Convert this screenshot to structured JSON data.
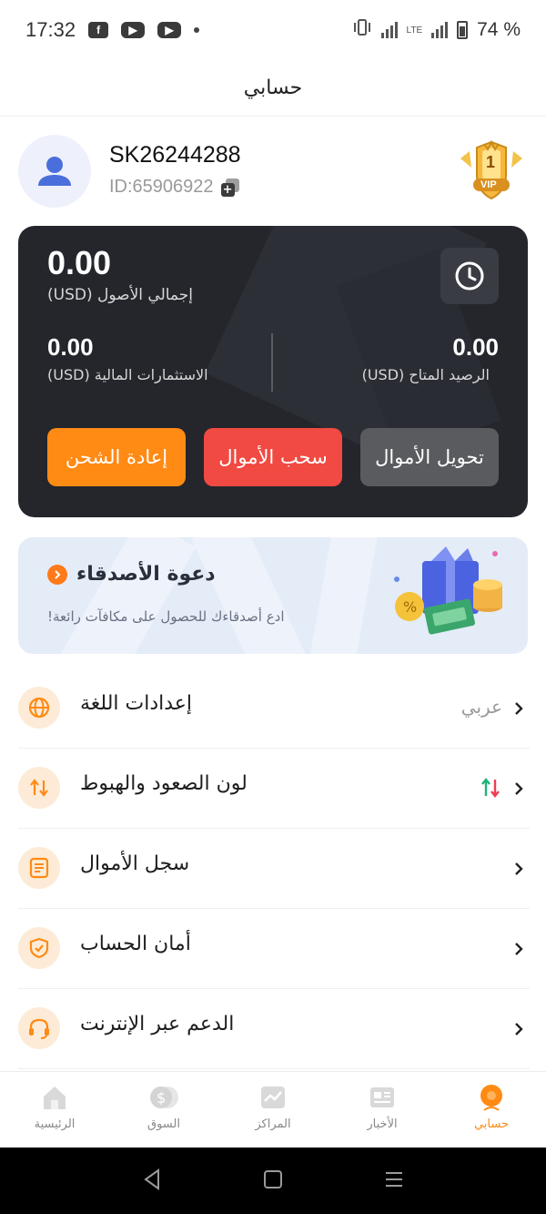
{
  "status_bar": {
    "time": "17:32",
    "apps": [
      "facebook-icon",
      "youtube-icon",
      "youtube-icon"
    ],
    "network": "LTE",
    "battery": "74 %"
  },
  "header": {
    "title": "حسابي"
  },
  "profile": {
    "username": "SK26244288",
    "user_id": "ID:65906922",
    "vip_level": "1",
    "vip_text": "VIP"
  },
  "assets": {
    "total_value": "0.00",
    "total_label": "إجمالي الأصول  (USD)",
    "investments_value": "0.00",
    "investments_label": "الاستثمارات المالية  (USD)",
    "available_value": "0.00",
    "available_label": "الرصيد المتاح  (USD)",
    "buttons": {
      "recharge": "إعادة الشحن",
      "withdraw": "سحب الأموال",
      "transfer": "تحويل الأموال"
    },
    "colors": {
      "recharge": "#ff8a14",
      "withdraw": "#f04a42",
      "transfer": "#5a5b5f"
    }
  },
  "invite": {
    "title": "دعوة الأصدقاء",
    "subtitle": "ادع أصدقاءك للحصول على مكافآت رائعة!"
  },
  "menu": [
    {
      "label": "إعدادات اللغة",
      "value": "عربي",
      "icon": "globe-icon"
    },
    {
      "label": "لون الصعود والهبوط",
      "value": "",
      "icon": "up-down-arrows-icon"
    },
    {
      "label": "سجل الأموال",
      "value": "",
      "icon": "document-icon"
    },
    {
      "label": "أمان الحساب",
      "value": "",
      "icon": "shield-icon"
    },
    {
      "label": "الدعم عبر الإنترنت",
      "value": "",
      "icon": "headset-icon"
    }
  ],
  "tabs": [
    {
      "label": "الرئيسية",
      "icon": "home-icon",
      "active": false
    },
    {
      "label": "السوق",
      "icon": "market-icon",
      "active": false
    },
    {
      "label": "المراكز",
      "icon": "positions-icon",
      "active": false
    },
    {
      "label": "الأخبار",
      "icon": "news-icon",
      "active": false
    },
    {
      "label": "حسابي",
      "icon": "account-icon",
      "active": true
    }
  ],
  "accent_color": "#ff8a14"
}
